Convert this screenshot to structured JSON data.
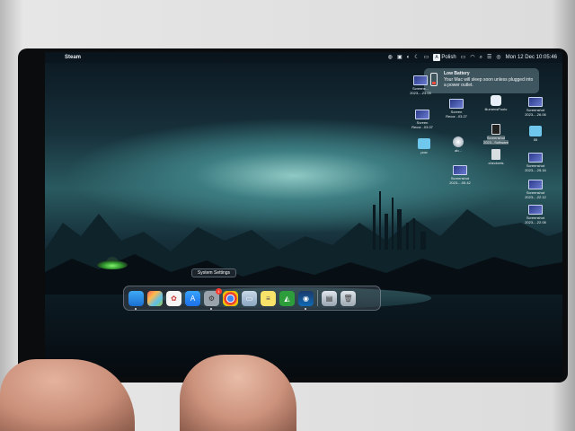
{
  "menubar": {
    "apple_glyph": "",
    "app_name": "Steam",
    "input_language": "Polish",
    "datetime": "Mon 12 Dec  10:05:46"
  },
  "notification": {
    "title": "Low Battery",
    "body": "Your Mac will sleep soon unless plugged into a power outlet."
  },
  "desktop_icons": [
    {
      "label": "Screens... 2023-...23.03",
      "kind": "shot"
    },
    {
      "label": "Screen Recor...03.27",
      "kind": "shot"
    },
    {
      "label": "Screen Recor...03.07",
      "kind": "shot"
    },
    {
      "label": "illumensFoolo",
      "kind": "app"
    },
    {
      "label": "Screenshot 2023-...26.06",
      "kind": "shot"
    },
    {
      "label": "pow",
      "kind": "folder"
    },
    {
      "label": "ab...",
      "kind": "disk"
    },
    {
      "label": "Screenshot 2023...Software",
      "kind": "figure",
      "selected": true
    },
    {
      "label": "55",
      "kind": "folder"
    },
    {
      "label": "checkrets",
      "kind": "file"
    },
    {
      "label": "Screenshot 2023-...25.16",
      "kind": "shot"
    },
    {
      "label": "Screenshot 2023-...05.42",
      "kind": "shot"
    },
    {
      "label": "Screenshot 2023-...22.12",
      "kind": "shot"
    },
    {
      "label": "Screenshot 2023-...22.08",
      "kind": "shot"
    }
  ],
  "dock": {
    "tooltip": "System Settings",
    "settings_badge": "1"
  },
  "colors": {
    "accent": "#ff3b30",
    "dock_bg": "#46505a"
  }
}
